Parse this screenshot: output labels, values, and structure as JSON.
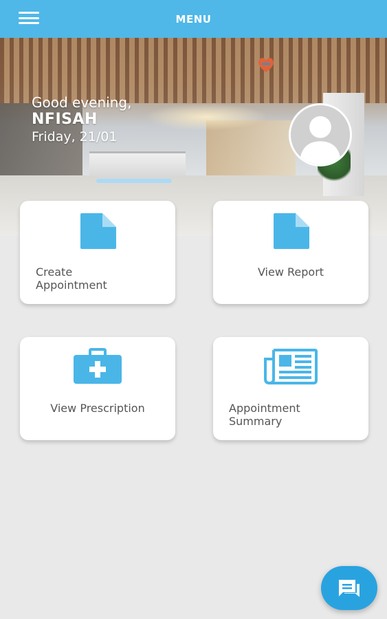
{
  "topbar": {
    "title": "MENU",
    "menu_icon": "hamburger-icon"
  },
  "hero": {
    "greeting": "Good evening,",
    "name": "NFISAH",
    "date": "Friday, 21/01",
    "avatar_icon": "user-avatar-icon",
    "logo_icon": "clinic-logo-icon"
  },
  "cards": [
    {
      "label": "Create\nAppointment",
      "icon": "document-icon"
    },
    {
      "label": "View Report",
      "icon": "document-icon"
    },
    {
      "label": "View Prescription",
      "icon": "medical-kit-icon"
    },
    {
      "label": "Appointment\nSummary",
      "icon": "newspaper-icon"
    }
  ],
  "fab": {
    "icon": "chat-icon"
  },
  "colors": {
    "primary": "#4fb8e8",
    "icon_blue": "#4ab6e8",
    "fab": "#29a3e0",
    "background": "#e9e9e9",
    "card_text": "#555555"
  }
}
